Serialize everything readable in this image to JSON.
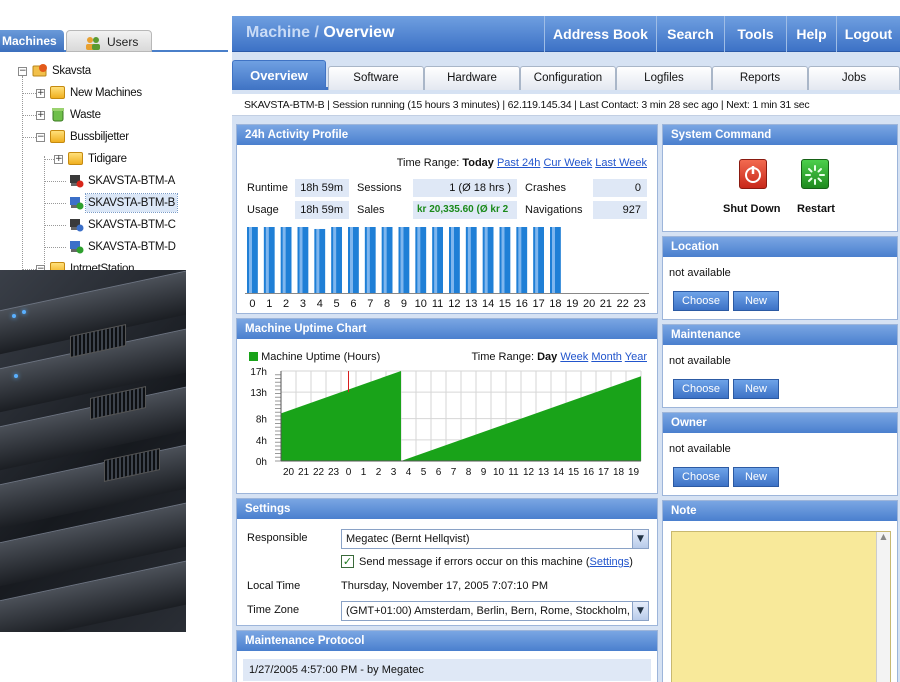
{
  "left_pane": {
    "tabs": [
      {
        "label": "Machines"
      },
      {
        "label": "Users"
      }
    ],
    "tree": [
      {
        "label": "Skavsta"
      },
      {
        "label": "New Machines"
      },
      {
        "label": "Waste"
      },
      {
        "label": "Bussbiljetter"
      },
      {
        "label": "Tidigare"
      },
      {
        "label": "SKAVSTA-BTM-A"
      },
      {
        "label": "SKAVSTA-BTM-B"
      },
      {
        "label": "SKAVSTA-BTM-C"
      },
      {
        "label": "SKAVSTA-BTM-D"
      },
      {
        "label": "IntrnetStation"
      }
    ]
  },
  "header": {
    "title_prefix": "Machine /",
    "title_main": "Overview",
    "nav": [
      "Address Book",
      "Search",
      "Tools",
      "Help",
      "Logout"
    ]
  },
  "tabs": [
    "Overview",
    "Software",
    "Hardware",
    "Configuration",
    "Logfiles",
    "Reports",
    "Jobs"
  ],
  "status_line": "SKAVSTA-BTM-B | Session running (15 hours 3 minutes) | 62.119.145.34 | Last Contact: 3 min 28 sec ago | Next: 1 min 31 sec",
  "activity": {
    "title": "24h Activity Profile",
    "time_range_label": "Time Range:",
    "time_range_current": "Today",
    "time_range_links": [
      "Past 24h",
      "Cur Week",
      "Last Week"
    ],
    "stats": [
      {
        "label": "Runtime",
        "value": "18h 59m"
      },
      {
        "label": "Sessions",
        "value": "1 (Ø 18 hrs )"
      },
      {
        "label": "Crashes",
        "value": "0"
      },
      {
        "label": "Usage",
        "value": "18h 59m"
      },
      {
        "label": "Sales",
        "value": "kr 20,335.60 (Ø kr 2"
      },
      {
        "label": "Navigations",
        "value": "927"
      }
    ],
    "accent": "#1f7fd6",
    "sales_color": "#1a8a1a"
  },
  "uptime": {
    "title": "Machine Uptime Chart",
    "legend": "Machine Uptime (Hours)",
    "time_range_label": "Time Range:",
    "time_range_current": "Day",
    "time_range_links": [
      "Week",
      "Month",
      "Year"
    ],
    "fill_color": "#19a319"
  },
  "chart_data": [
    {
      "type": "bar",
      "title": "24h Activity Profile",
      "categories": [
        "0",
        "1",
        "2",
        "3",
        "4",
        "5",
        "6",
        "7",
        "8",
        "9",
        "10",
        "11",
        "12",
        "13",
        "14",
        "15",
        "16",
        "17",
        "18",
        "19",
        "20",
        "21",
        "22",
        "23"
      ],
      "values": [
        100,
        100,
        100,
        100,
        97,
        100,
        100,
        100,
        100,
        100,
        100,
        100,
        100,
        100,
        100,
        100,
        100,
        100,
        100,
        0,
        0,
        0,
        0,
        0
      ],
      "ylim": [
        0,
        100
      ]
    },
    {
      "type": "area",
      "title": "Machine Uptime Chart",
      "series": [
        {
          "name": "Machine Uptime (Hours)"
        }
      ],
      "x": [
        "20",
        "21",
        "22",
        "23",
        "0",
        "1",
        "2",
        "3",
        "4",
        "5",
        "6",
        "7",
        "8",
        "9",
        "10",
        "11",
        "12",
        "13",
        "14",
        "15",
        "16",
        "17",
        "18",
        "19"
      ],
      "y": [
        9,
        10,
        11,
        12,
        13,
        14,
        15,
        16,
        0,
        1,
        2,
        3,
        4,
        5,
        6,
        7,
        8,
        9,
        10,
        11,
        12,
        13,
        14,
        15
      ],
      "yticks": [
        "0h",
        "4h",
        "8h",
        "13h",
        "17h"
      ],
      "ylim": [
        0,
        17
      ],
      "grid": true,
      "legend": "top-left"
    }
  ],
  "settings": {
    "title": "Settings",
    "responsible_label": "Responsible",
    "responsible_value": "Megatec (Bernt Hellqvist)",
    "notify_text": "Send message if errors occur on this machine (",
    "notify_link": "Settings",
    "notify_close": ")",
    "local_time_label": "Local Time",
    "local_time_value": "Thursday, November 17, 2005 7:07:10 PM",
    "tz_label": "Time Zone",
    "tz_value": "(GMT+01:00) Amsterdam, Berlin, Bern, Rome, Stockholm, Vie"
  },
  "maintenance_protocol": {
    "title": "Maintenance Protocol",
    "entry": "1/27/2005 4:57:00 PM - by Megatec"
  },
  "system_command": {
    "title": "System Command",
    "shutdown_label": "Shut Down",
    "restart_label": "Restart"
  },
  "location": {
    "title": "Location",
    "value": "not available",
    "choose": "Choose",
    "new": "New"
  },
  "maintenance": {
    "title": "Maintenance",
    "value": "not available",
    "choose": "Choose",
    "new": "New"
  },
  "owner": {
    "title": "Owner",
    "value": "not available",
    "choose": "Choose",
    "new": "New"
  },
  "note": {
    "title": "Note",
    "bg": "#f8e99a"
  }
}
